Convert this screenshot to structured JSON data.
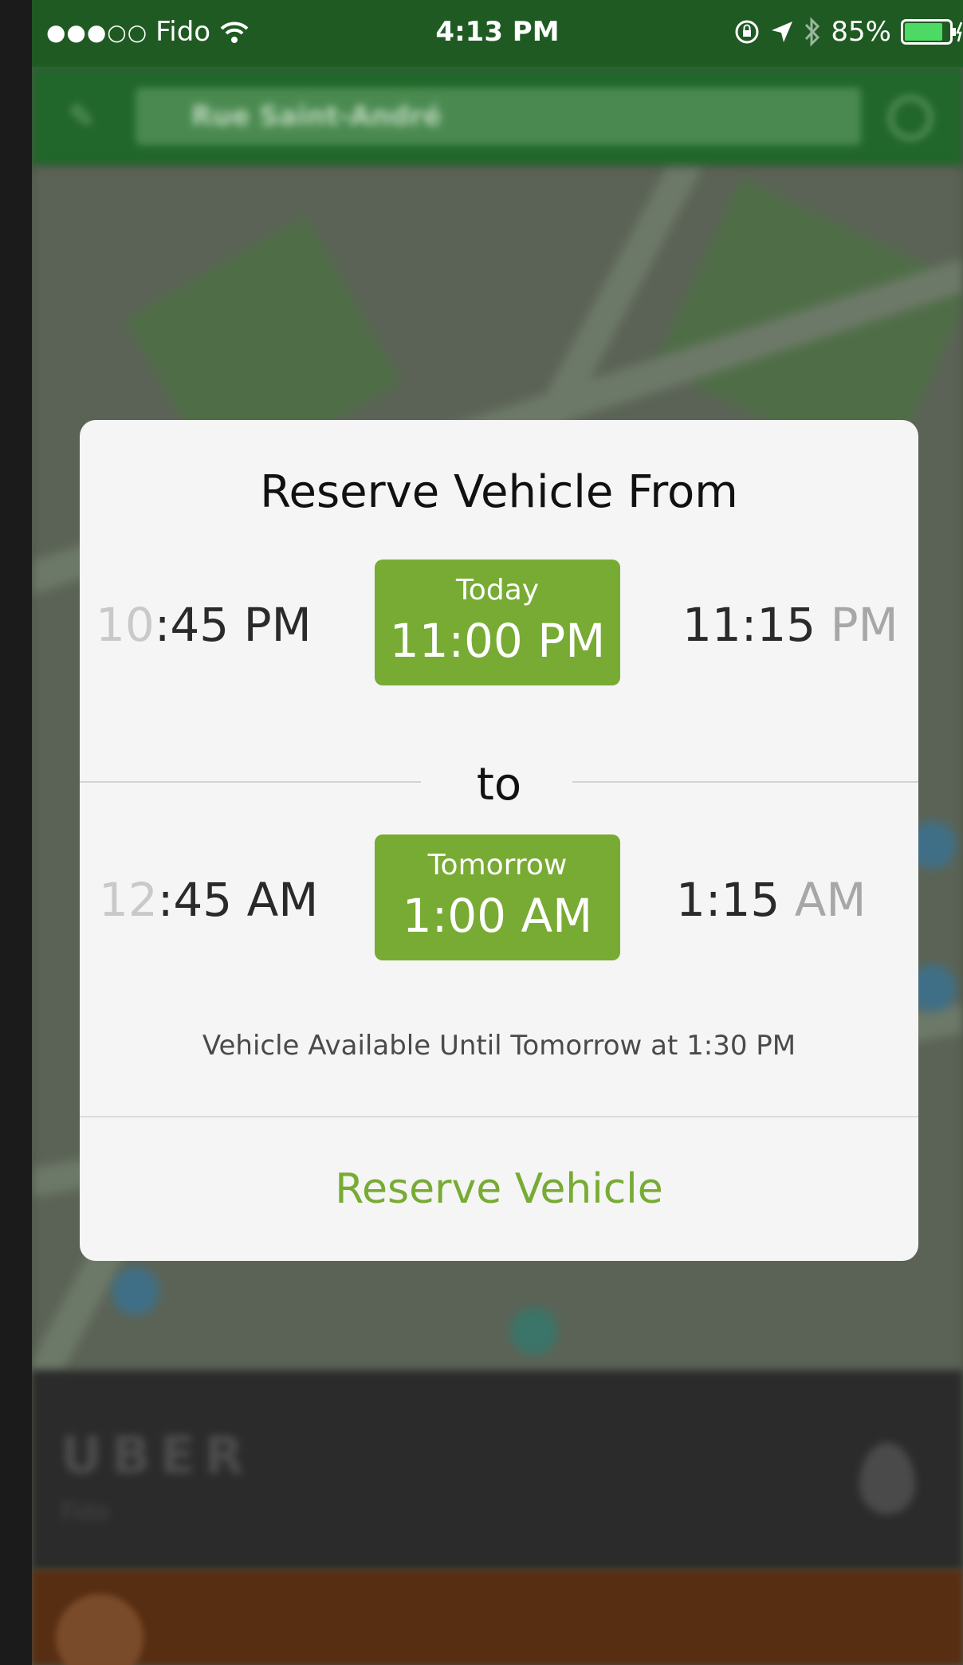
{
  "status_bar": {
    "signal": "●●●○○",
    "carrier": "Fido",
    "time": "4:13 PM",
    "battery_percent": "85%",
    "battery_level": 0.85
  },
  "background": {
    "search_text": "Rue Saint-André",
    "brand_text": "UBER",
    "brand_sub": "Fido"
  },
  "modal": {
    "title": "Reserve Vehicle From",
    "from": {
      "prev_hour": "10",
      "prev_rest": ":45",
      "prev_period": "PM",
      "selected_day": "Today",
      "selected_time": "11:00 PM",
      "next_hour": "11:15",
      "next_period": "PM"
    },
    "separator": "to",
    "to": {
      "prev_hour": "12",
      "prev_rest": ":45",
      "prev_period": "AM",
      "selected_day": "Tomorrow",
      "selected_time": "1:00 AM",
      "next_hour": "1:15",
      "next_period": "AM"
    },
    "availability": "Vehicle Available Until Tomorrow at 1:30 PM",
    "reserve_label": "Reserve Vehicle"
  },
  "colors": {
    "accent_green": "#78ab34",
    "status_bar_green": "#1f5a22"
  }
}
